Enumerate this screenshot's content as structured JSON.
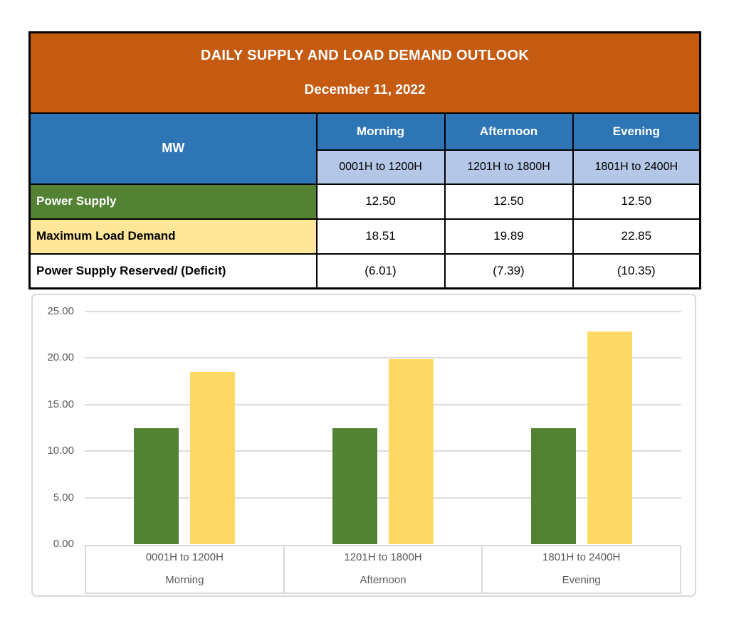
{
  "table": {
    "title": "DAILY SUPPLY AND LOAD DEMAND OUTLOOK",
    "date": "December 11, 2022",
    "unit_header": "MW",
    "periods": [
      {
        "name": "Morning",
        "hours": "0001H to 1200H"
      },
      {
        "name": "Afternoon",
        "hours": "1201H to 1800H"
      },
      {
        "name": "Evening",
        "hours": "1801H to 2400H"
      }
    ],
    "rows": [
      {
        "label": "Power Supply",
        "values": [
          "12.50",
          "12.50",
          "12.50"
        ]
      },
      {
        "label": "Maximum Load Demand",
        "values": [
          "18.51",
          "19.89",
          "22.85"
        ]
      },
      {
        "label": "Power Supply Reserved/ (Deficit)",
        "values": [
          "(6.01)",
          "(7.39)",
          "(10.35)"
        ]
      }
    ]
  },
  "colors": {
    "header_orange": "#C55A11",
    "header_blue": "#2E75B6",
    "header_light_blue": "#B4C7E7",
    "row_green": "#548235",
    "row_yellow": "#FFE699",
    "bar_green": "#548235",
    "bar_yellow": "#FFD966",
    "axis_text": "#595959",
    "gridline": "#D9D9D9"
  },
  "chart_data": {
    "type": "bar",
    "title": "",
    "xlabel": "",
    "ylabel": "",
    "categories": [
      {
        "hours": "0001H to 1200H",
        "name": "Morning"
      },
      {
        "hours": "1201H to 1800H",
        "name": "Afternoon"
      },
      {
        "hours": "1801H to 2400H",
        "name": "Evening"
      }
    ],
    "series": [
      {
        "name": "Power Supply",
        "color": "#548235",
        "values": [
          12.5,
          12.5,
          12.5
        ]
      },
      {
        "name": "Maximum Load Demand",
        "color": "#FFD966",
        "values": [
          18.51,
          19.89,
          22.85
        ]
      }
    ],
    "ylim": [
      0,
      25
    ],
    "ytick_step": 5,
    "ytick_labels": [
      "0.00",
      "5.00",
      "10.00",
      "15.00",
      "20.00",
      "25.00"
    ],
    "grid": true,
    "legend_position": "none"
  }
}
